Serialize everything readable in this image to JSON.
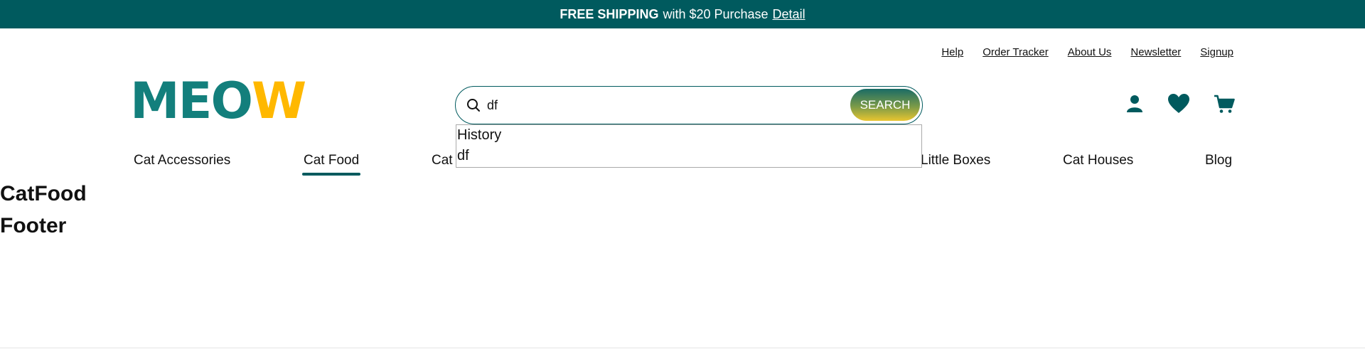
{
  "announcement": {
    "bold": "FREE SHIPPING",
    "text": "with $20 Purchase",
    "link": "Detail"
  },
  "utility_links": [
    "Help",
    "Order Tracker",
    "About Us",
    "Newsletter",
    "Signup"
  ],
  "logo": {
    "part1": "MEO",
    "part2": "W"
  },
  "search": {
    "value": "df",
    "button_label": "SEARCH",
    "suggestions": {
      "header": "History",
      "items": [
        "df"
      ]
    }
  },
  "header_icons": [
    "user-icon",
    "heart-icon",
    "cart-icon"
  ],
  "nav": {
    "items": [
      "Cat Accessories",
      "Cat Food",
      "Cat",
      "Little Boxes",
      "Cat Houses",
      "Blog"
    ],
    "active": "Cat Food"
  },
  "content": {
    "heading": "CatFood",
    "footer": "Footer"
  },
  "colors": {
    "brand": "#005a5e",
    "logo_teal": "#137f7c",
    "logo_yellow": "#ffb800"
  }
}
